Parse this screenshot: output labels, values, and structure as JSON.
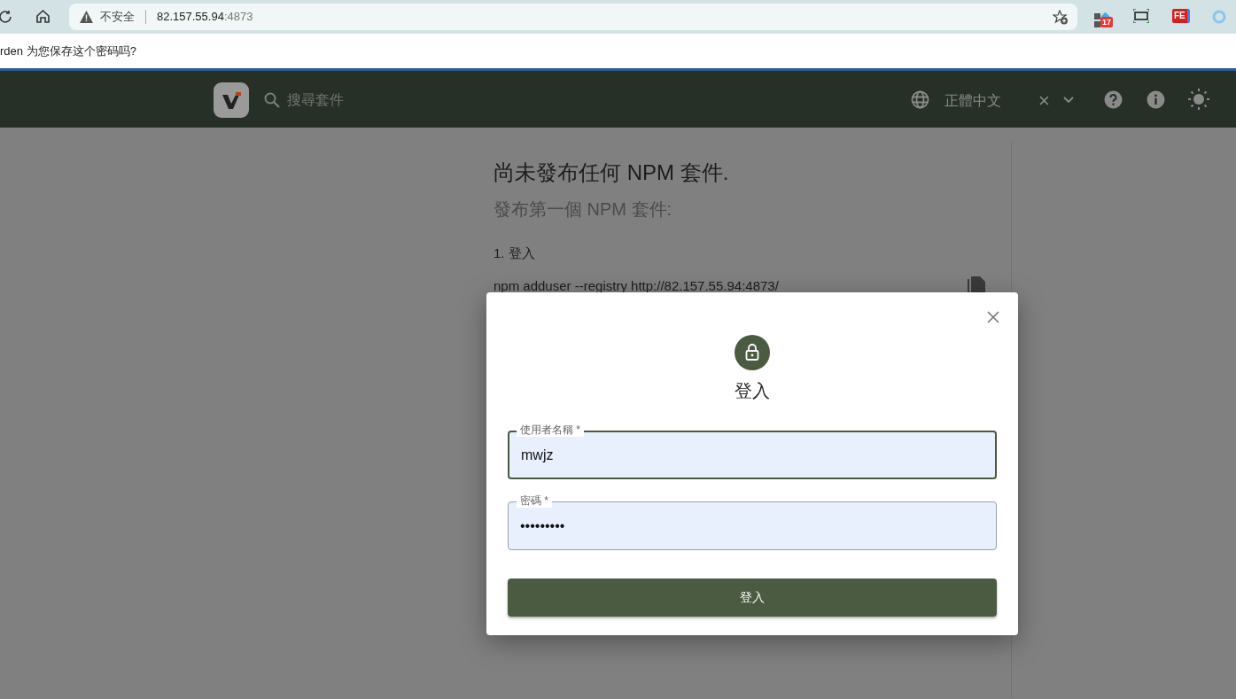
{
  "browser": {
    "security_label": "不安全",
    "url_host": "82.157.55.94",
    "url_port": ":4873",
    "extension_badge": "17",
    "extension_label": "FE"
  },
  "infobar": {
    "text": "rden 为您保存这个密码吗?"
  },
  "header": {
    "search_placeholder": "搜尋套件",
    "language": "正體中文",
    "clear": "×"
  },
  "content": {
    "title": "尚未發布任何 NPM 套件.",
    "subtitle": "發布第一個 NPM 套件:",
    "step": "1. 登入",
    "command": "npm adduser --registry http://82.157.55.94:4873/"
  },
  "dialog": {
    "title": "登入",
    "fields": [
      {
        "label": "使用者名稱 *",
        "value": "mwjz",
        "focused": true
      },
      {
        "label": "密碼 *",
        "value": "•••••••••",
        "focused": false
      }
    ],
    "submit": "登入"
  }
}
